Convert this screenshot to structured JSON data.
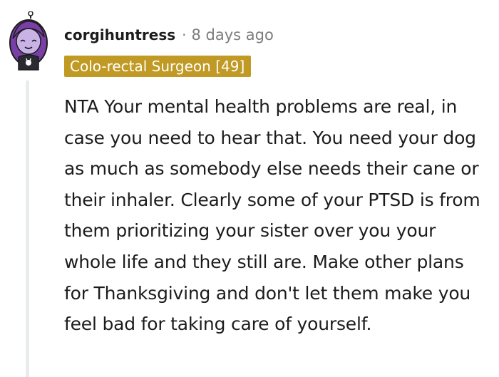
{
  "comment": {
    "username": "corgihuntress",
    "separator": "·",
    "timestamp": "8 days ago",
    "flair": "Colo-rectal Surgeon [49]",
    "body": "NTA Your mental health problems are real, in case you need to hear that. You need your dog as much as somebody else needs their cane or their inhaler. Clearly some of your PTSD is from them prioritizing your sister over you your whole life and they still are. Make other plans for Thanksgiving and don't let them make you feel bad for taking care of yourself.",
    "avatar_icon": "snoo-avatar-icon",
    "colors": {
      "flair_background": "#c09a24",
      "flair_text": "#ffffff",
      "muted_text": "#7c7c7c",
      "body_text": "#1c1c1c",
      "thread_line": "#e9ebed",
      "avatar_hair": "#7a3fa6"
    }
  }
}
